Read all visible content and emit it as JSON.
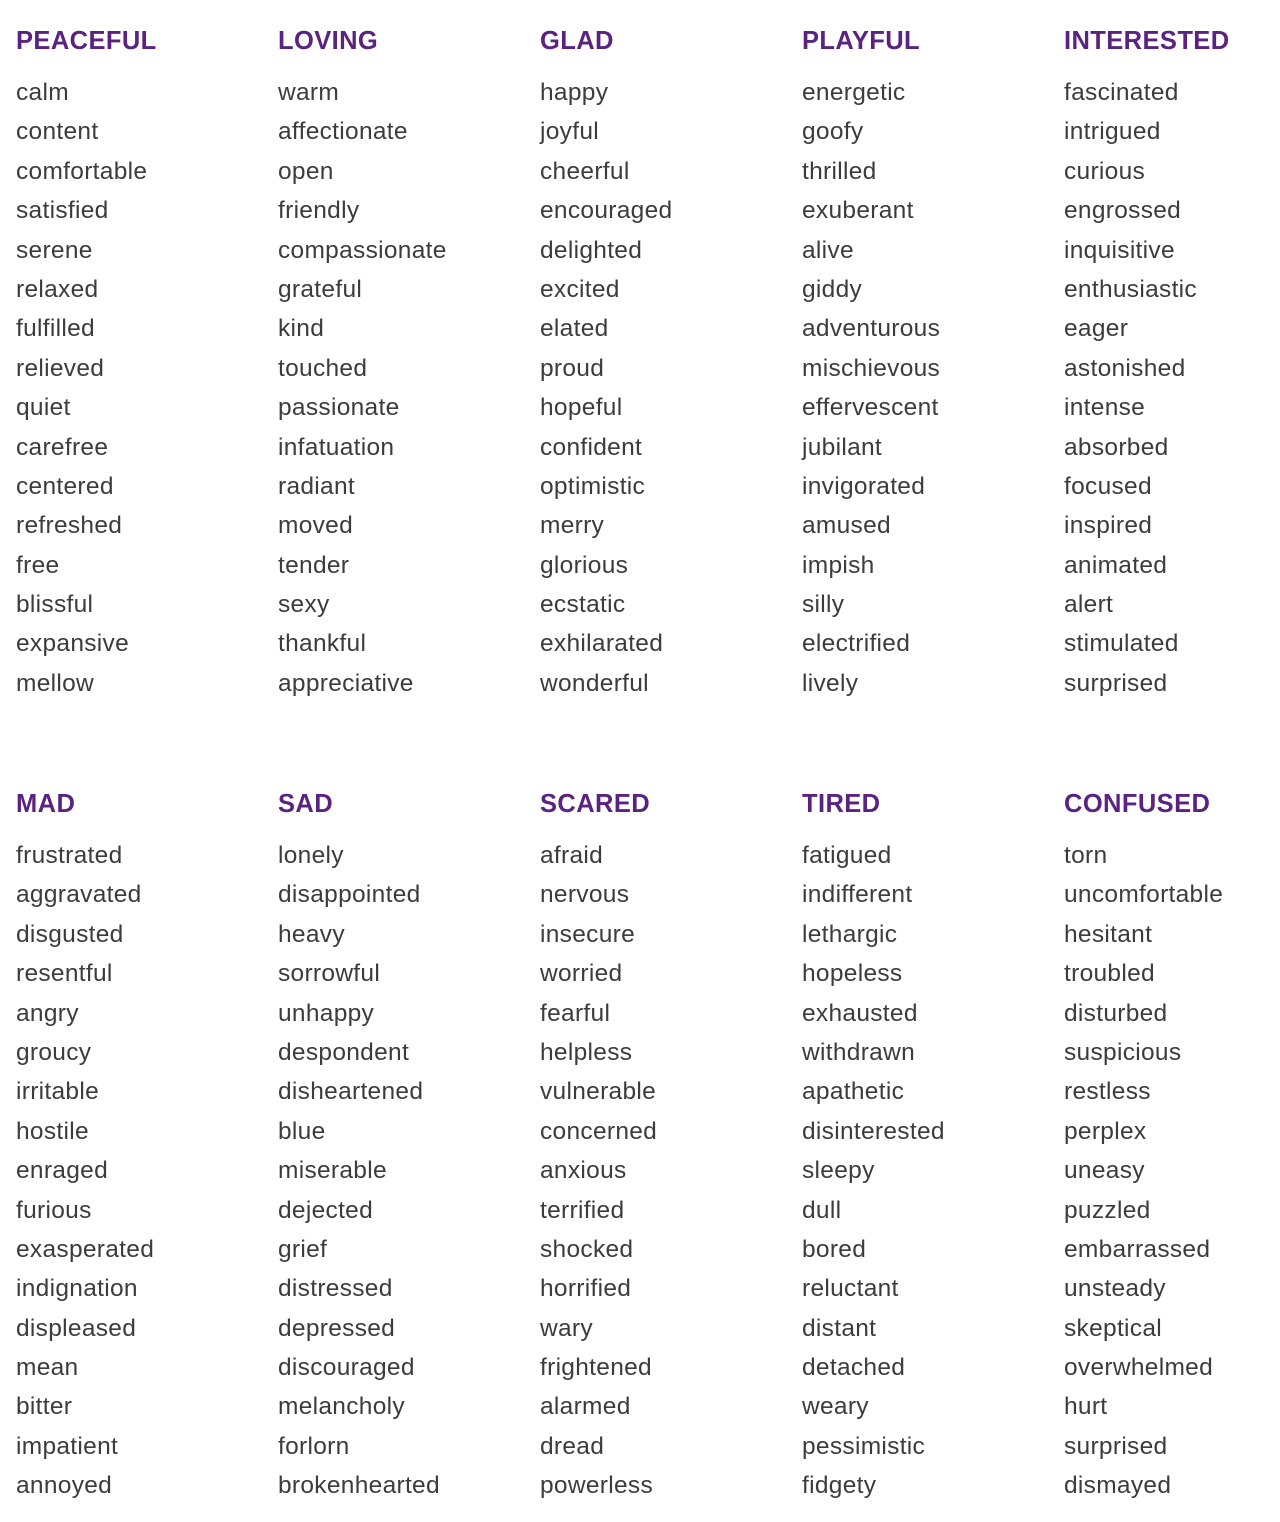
{
  "sections": [
    {
      "columns": [
        {
          "heading": "PEACEFUL",
          "words": [
            "calm",
            "content",
            "comfortable",
            "satisfied",
            "serene",
            "relaxed",
            "fulfilled",
            "relieved",
            "quiet",
            "carefree",
            "centered",
            "refreshed",
            "free",
            "blissful",
            "expansive",
            "mellow"
          ]
        },
        {
          "heading": "LOVING",
          "words": [
            "warm",
            "affectionate",
            "open",
            "friendly",
            "compassionate",
            "grateful",
            "kind",
            "touched",
            "passionate",
            "infatuation",
            "radiant",
            "moved",
            "tender",
            "sexy",
            "thankful",
            "appreciative"
          ]
        },
        {
          "heading": "GLAD",
          "words": [
            "happy",
            "joyful",
            "cheerful",
            "encouraged",
            "delighted",
            "excited",
            "elated",
            "proud",
            "hopeful",
            "confident",
            "optimistic",
            "merry",
            "glorious",
            "ecstatic",
            "exhilarated",
            "wonderful"
          ]
        },
        {
          "heading": "PLAYFUL",
          "words": [
            "energetic",
            "goofy",
            "thrilled",
            "exuberant",
            "alive",
            "giddy",
            "adventurous",
            "mischievous",
            "effervescent",
            "jubilant",
            "invigorated",
            "amused",
            "impish",
            "silly",
            "electrified",
            "lively"
          ]
        },
        {
          "heading": "INTERESTED",
          "words": [
            "fascinated",
            "intrigued",
            "curious",
            "engrossed",
            "inquisitive",
            "enthusiastic",
            "eager",
            "astonished",
            "intense",
            "absorbed",
            "focused",
            "inspired",
            "animated",
            "alert",
            "stimulated",
            "surprised"
          ]
        }
      ]
    },
    {
      "columns": [
        {
          "heading": "MAD",
          "words": [
            "frustrated",
            "aggravated",
            "disgusted",
            "resentful",
            "angry",
            "groucy",
            "irritable",
            "hostile",
            "enraged",
            "furious",
            "exasperated",
            "indignation",
            "displeased",
            "mean",
            "bitter",
            "impatient",
            "annoyed"
          ]
        },
        {
          "heading": "SAD",
          "words": [
            "lonely",
            "disappointed",
            "heavy",
            "sorrowful",
            "unhappy",
            "despondent",
            "disheartened",
            "blue",
            "miserable",
            "dejected",
            "grief",
            "distressed",
            "depressed",
            "discouraged",
            "melancholy",
            "forlorn",
            "brokenhearted"
          ]
        },
        {
          "heading": "SCARED",
          "words": [
            "afraid",
            "nervous",
            "insecure",
            "worried",
            "fearful",
            "helpless",
            "vulnerable",
            "concerned",
            "anxious",
            "terrified",
            "shocked",
            "horrified",
            "wary",
            "frightened",
            "alarmed",
            "dread",
            "powerless"
          ]
        },
        {
          "heading": "TIRED",
          "words": [
            "fatigued",
            "indifferent",
            "lethargic",
            "hopeless",
            "exhausted",
            "withdrawn",
            "apathetic",
            "disinterested",
            "sleepy",
            "dull",
            "bored",
            "reluctant",
            "distant",
            "detached",
            "weary",
            "pessimistic",
            "fidgety"
          ]
        },
        {
          "heading": "CONFUSED",
          "words": [
            "torn",
            "uncomfortable",
            "hesitant",
            "troubled",
            "disturbed",
            "suspicious",
            "restless",
            "perplex",
            "uneasy",
            "puzzled",
            "embarrassed",
            "unsteady",
            "skeptical",
            "overwhelmed",
            "hurt",
            "surprised",
            "dismayed"
          ]
        }
      ]
    }
  ]
}
